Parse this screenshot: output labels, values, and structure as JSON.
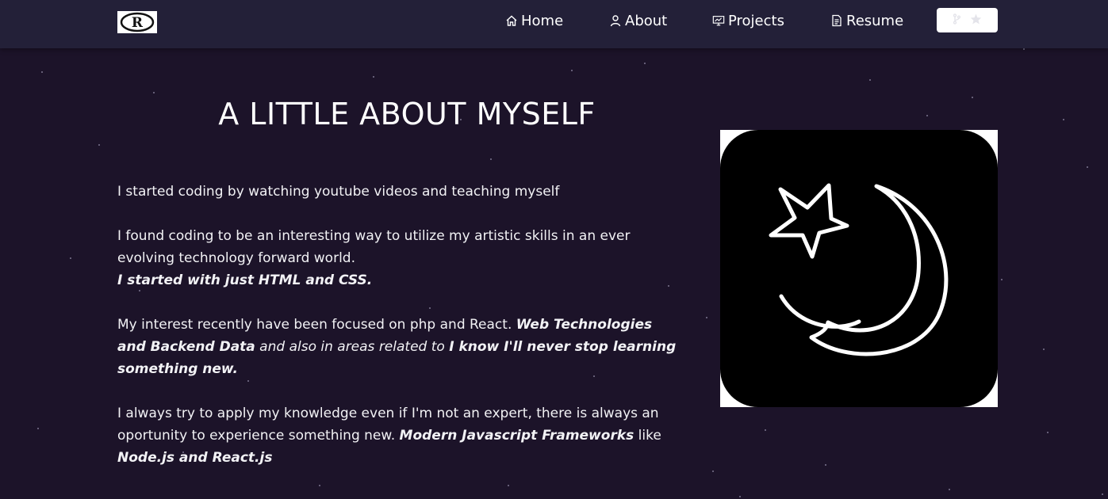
{
  "nav": {
    "logo_text": "R",
    "items": [
      {
        "label": "Home",
        "icon": "home-icon"
      },
      {
        "label": "About",
        "icon": "user-icon"
      },
      {
        "label": "Projects",
        "icon": "presentation-icon"
      },
      {
        "label": "Resume",
        "icon": "document-icon"
      }
    ],
    "github_button_icons": [
      "fork-icon",
      "star-icon"
    ]
  },
  "about": {
    "title": "A LITTLE ABOUT MYSELF",
    "p1": "I started coding by watching youtube videos and teaching myself",
    "p2": "I found coding to be an interesting way to utilize my artistic skills in an ever evolving technology forward world.",
    "p2_emph": "I started with just HTML and CSS.",
    "p3_a": "My interest recently have been focused on php and React. ",
    "p3_b": "Web Technologies and Backend Data",
    "p3_c": " and also in areas related to ",
    "p3_d": "I know I'll never stop learning something new.",
    "p4_a": "I always try to apply my knowledge even if I'm not an expert, there is always an oportunity to experience something new. ",
    "p4_b": "Modern Javascript Frameworks",
    "p4_c": "  like ",
    "p4_d": "Node.js and React.js"
  },
  "avatar": {
    "icon": "star-and-crescent-icon"
  },
  "colors": {
    "background": "#1c1329",
    "navbar": "#232038",
    "text": "#ffffff"
  }
}
